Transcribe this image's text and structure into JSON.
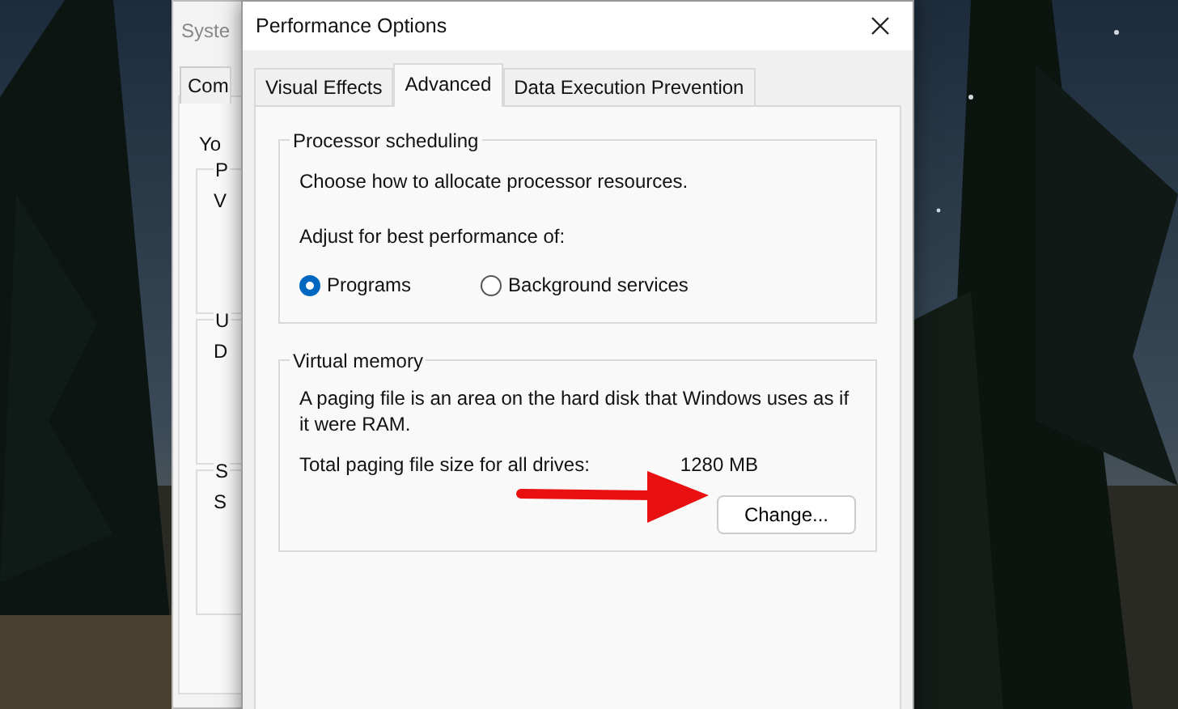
{
  "background_window": {
    "title": "Syste",
    "tab": "Com",
    "text": "Yo",
    "groups": [
      {
        "legend": "P",
        "text": "V"
      },
      {
        "legend": "U",
        "text": "D"
      },
      {
        "legend": "S",
        "text": "S"
      }
    ]
  },
  "dialog": {
    "title": "Performance Options",
    "tabs": [
      {
        "label": "Visual Effects",
        "selected": false
      },
      {
        "label": "Advanced",
        "selected": true
      },
      {
        "label": "Data Execution Prevention",
        "selected": false
      }
    ],
    "processor_scheduling": {
      "legend": "Processor scheduling",
      "description": "Choose how to allocate processor resources.",
      "prompt": "Adjust for best performance of:",
      "options": [
        {
          "label": "Programs",
          "selected": true
        },
        {
          "label": "Background services",
          "selected": false
        }
      ]
    },
    "virtual_memory": {
      "legend": "Virtual memory",
      "description": "A paging file is an area on the hard disk that Windows uses as if it were RAM.",
      "total_label": "Total paging file size for all drives:",
      "total_value": "1280 MB",
      "button": "Change..."
    }
  }
}
